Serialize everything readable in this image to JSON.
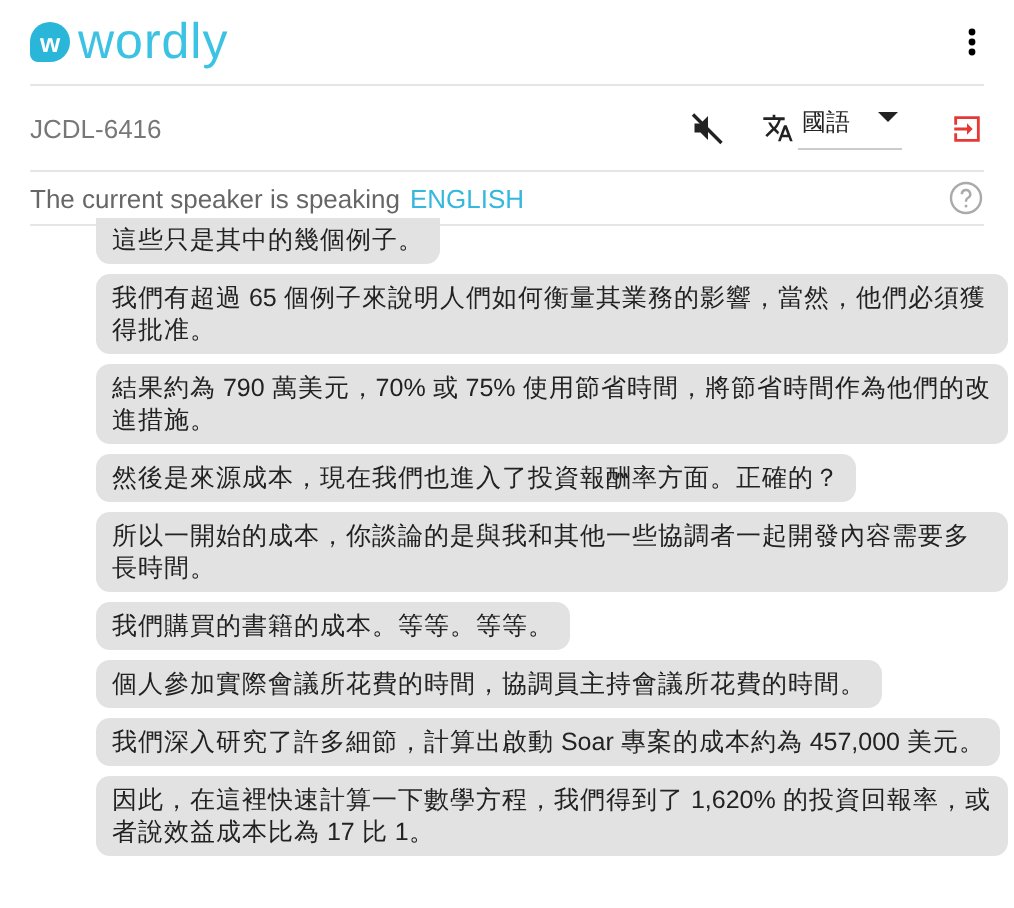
{
  "header": {
    "logo_mark": "w",
    "logo_text": "wordly"
  },
  "session": {
    "code": "JCDL-6416",
    "audio_muted": true,
    "language": "國語"
  },
  "speaker": {
    "label": "The current speaker is speaking",
    "language": "ENGLISH"
  },
  "messages": [
    {
      "text": "這些只是其中的幾個例子。"
    },
    {
      "text": "我們有超過 65 個例子來說明人們如何衡量其業務的影響，當然，他們必須獲得批准。"
    },
    {
      "text": "結果約為 790 萬美元，70% 或 75% 使用節省時間，將節省時間作為他們的改進措施。"
    },
    {
      "text": "然後是來源成本，現在我們也進入了投資報酬率方面。正確的？"
    },
    {
      "text": "所以一開始的成本，你談論的是與我和其他一些協調者一起開發內容需要多長時間。"
    },
    {
      "text": "我們購買的書籍的成本。等等。等等。"
    },
    {
      "text": "個人參加實際會議所花費的時間，協調員主持會議所花費的時間。"
    },
    {
      "text": "我們深入研究了許多細節，計算出啟動 Soar 專案的成本約為 457,000 美元。"
    },
    {
      "text": "因此，在這裡快速計算一下數學方程，我們得到了 1,620% 的投資回報率，或者說效益成本比為 17 比 1。"
    }
  ]
}
